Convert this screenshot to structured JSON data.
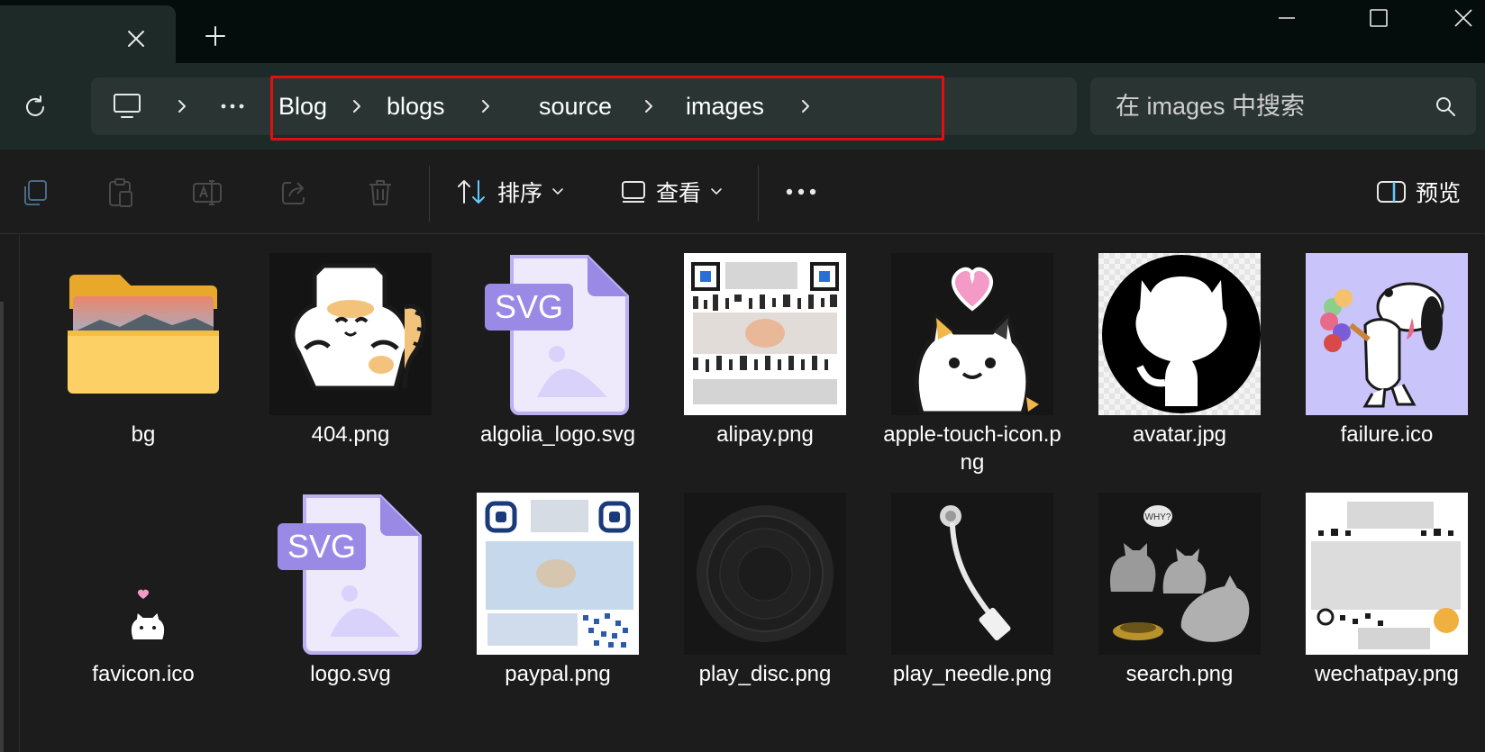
{
  "window": {
    "tab_close_icon": "close-icon",
    "new_tab_icon": "plus-icon",
    "controls": [
      "minimize-icon",
      "maximize-icon",
      "close-icon"
    ]
  },
  "address": {
    "refresh_icon": "refresh-icon",
    "root_icon": "computer-icon",
    "more_label": "···",
    "crumbs": [
      "Blog",
      "blogs",
      "source",
      "images"
    ],
    "search_placeholder": "在 images 中搜索"
  },
  "toolbar": {
    "sort_label": "排序",
    "view_label": "查看",
    "more_label": "•••",
    "preview_label": "预览",
    "icons": [
      "copy-icon",
      "paste-icon",
      "rename-icon",
      "share-icon",
      "delete-icon"
    ]
  },
  "files": [
    {
      "name": "bg",
      "kind": "folder"
    },
    {
      "name": "404.png",
      "kind": "cat-sticker"
    },
    {
      "name": "algolia_logo.svg",
      "kind": "svg"
    },
    {
      "name": "alipay.png",
      "kind": "qr"
    },
    {
      "name": "apple-touch-icon.png",
      "kind": "cat-heart"
    },
    {
      "name": "avatar.jpg",
      "kind": "github"
    },
    {
      "name": "failure.ico",
      "kind": "snoopy"
    },
    {
      "name": "favicon.ico",
      "kind": "tiny-cat"
    },
    {
      "name": "logo.svg",
      "kind": "svg"
    },
    {
      "name": "paypal.png",
      "kind": "qr-blue"
    },
    {
      "name": "play_disc.png",
      "kind": "disc"
    },
    {
      "name": "play_needle.png",
      "kind": "needle"
    },
    {
      "name": "search.png",
      "kind": "cats"
    },
    {
      "name": "wechatpay.png",
      "kind": "qr-wechat"
    }
  ],
  "colors": {
    "titlebar": "#040c0c",
    "addressbar": "#1e2a28",
    "field": "#2a3533",
    "background": "#1c1c1c",
    "highlight": "#e01010",
    "accent": "#60cdff"
  }
}
